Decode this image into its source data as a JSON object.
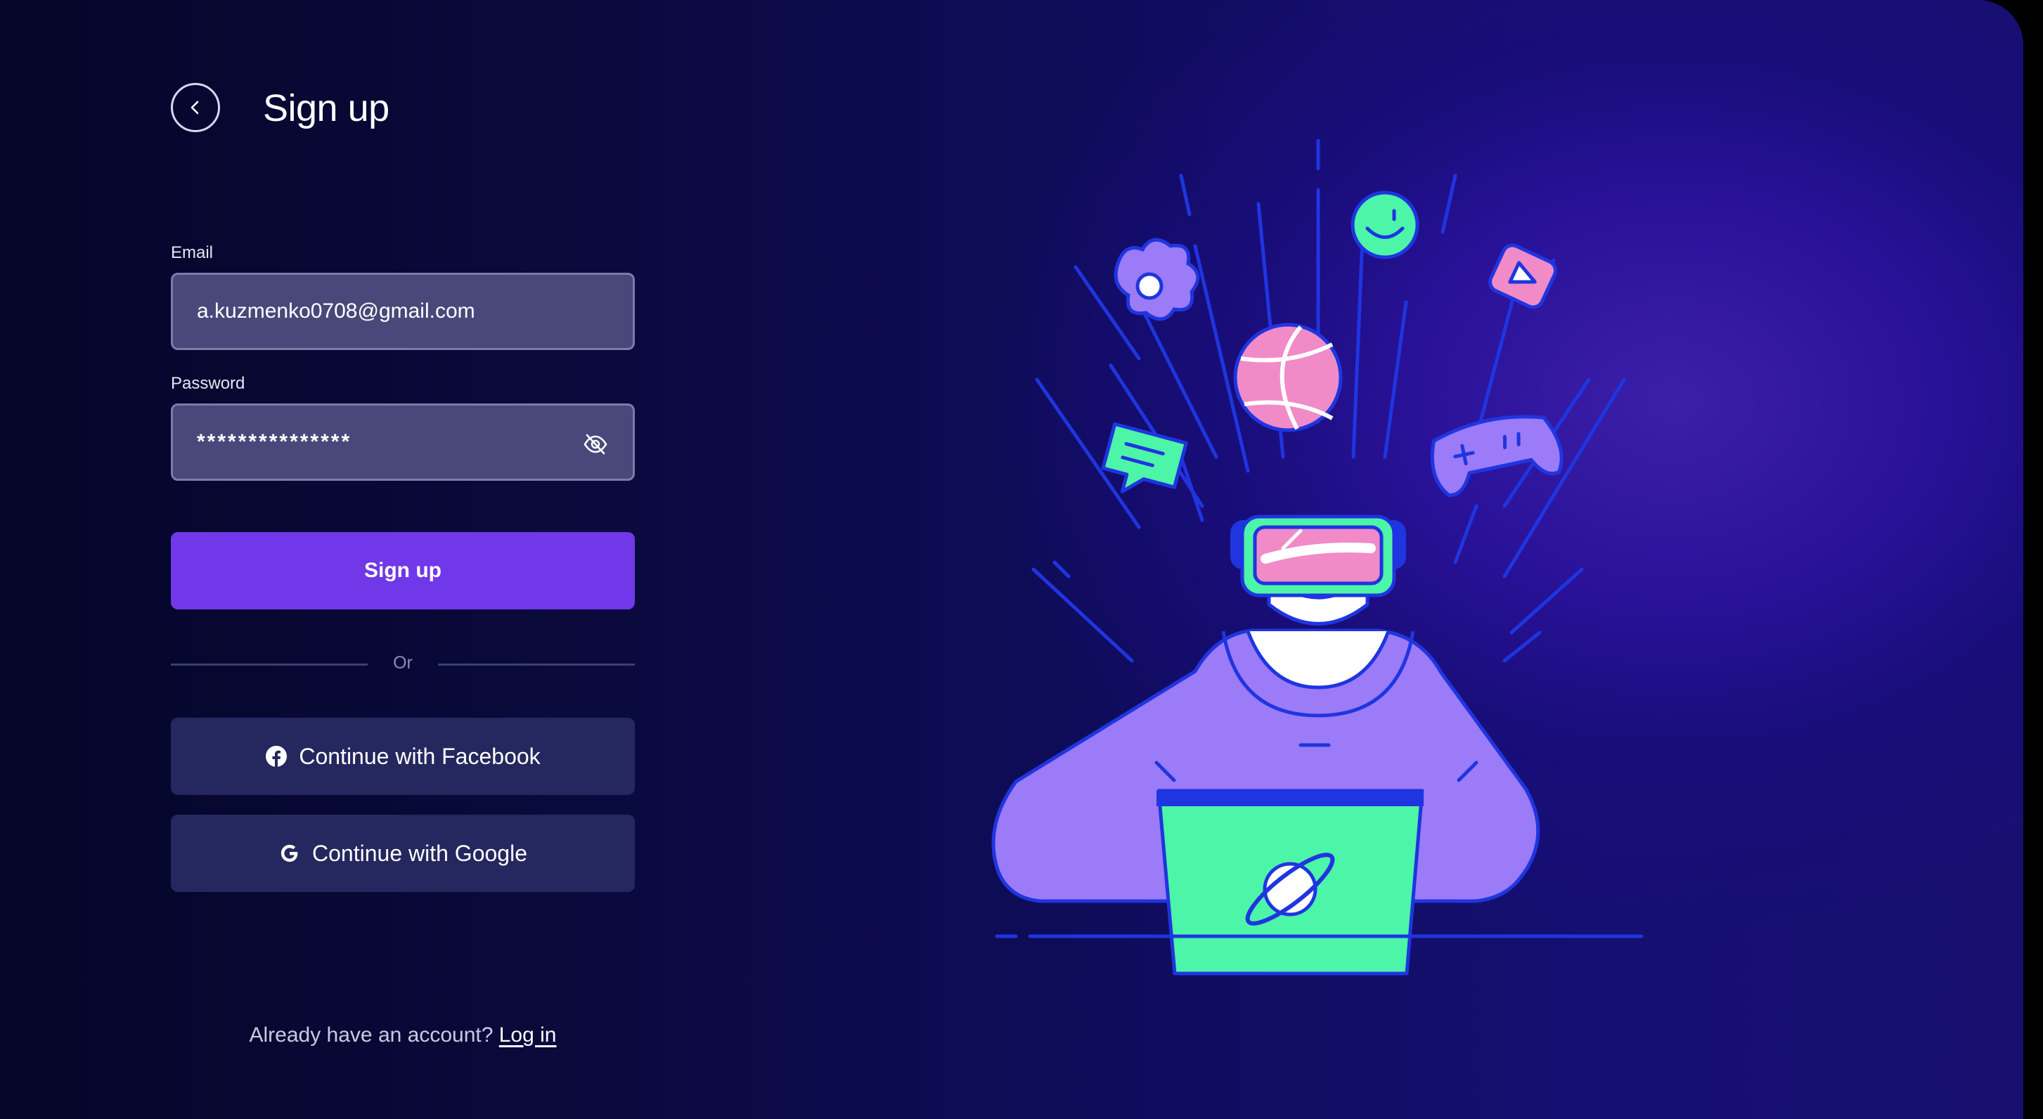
{
  "header": {
    "title": "Sign up"
  },
  "form": {
    "email_label": "Email",
    "email_value": "a.kuzmenko0708@gmail.com",
    "password_label": "Password",
    "password_mask": "***************",
    "submit_label": "Sign up"
  },
  "divider": {
    "label": "Or"
  },
  "social": {
    "facebook_label": "Continue with Facebook",
    "google_label": "Continue with Google"
  },
  "footer": {
    "prompt": "Already have an account? ",
    "login_link": "Log in"
  },
  "icons": {
    "back": "chevron-left-icon",
    "password_toggle": "eye-off-icon",
    "facebook": "facebook-icon",
    "google": "google-icon"
  },
  "colors": {
    "primary": "#7038e8",
    "field_bg": "#48487a",
    "social_bg": "#25285e",
    "illustration_green": "#4cf5a8",
    "illustration_purple": "#9b7bf7",
    "illustration_pink": "#f08bc8",
    "illustration_blue": "#1f35e0"
  }
}
